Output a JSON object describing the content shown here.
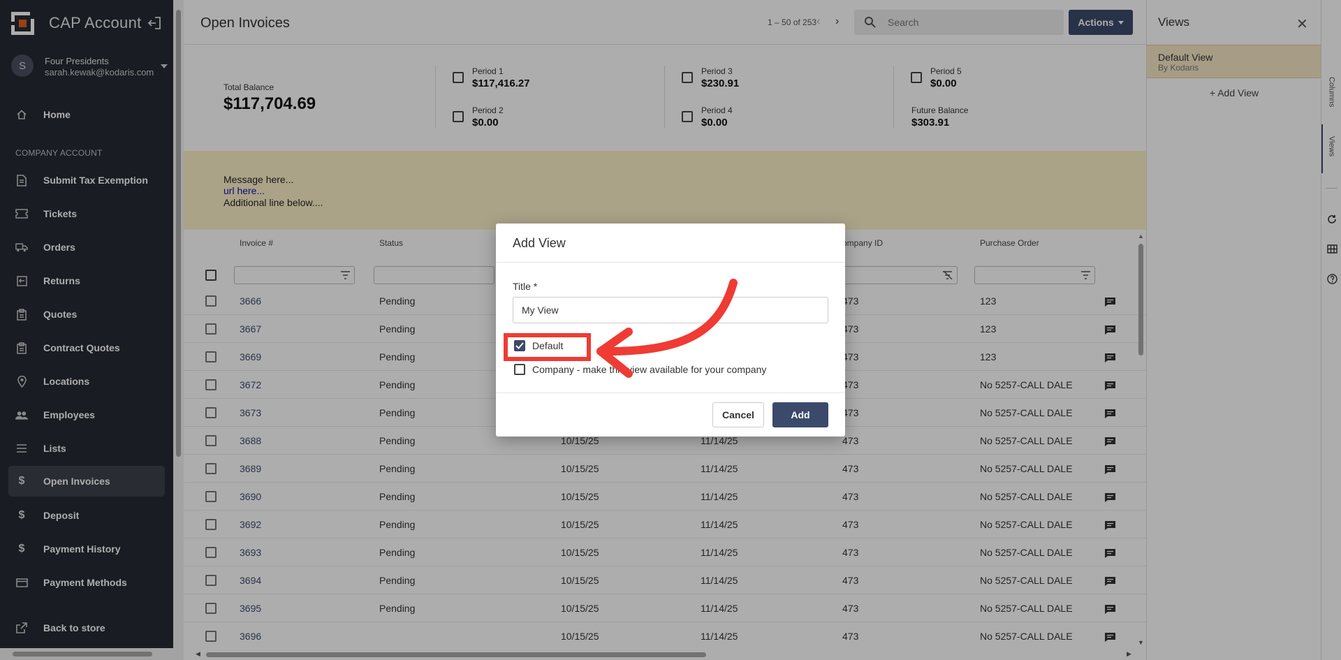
{
  "app": {
    "title": "CAP Account"
  },
  "user": {
    "initial": "S",
    "name": "Four Presidents",
    "email": "sarah.kewak@kodaris.com"
  },
  "sidebar": {
    "section_label": "COMPANY ACCOUNT",
    "items": [
      {
        "label": "Home",
        "icon": "home-icon"
      },
      {
        "label": "Submit Tax Exemption",
        "icon": "document-icon"
      },
      {
        "label": "Tickets",
        "icon": "ticket-icon"
      },
      {
        "label": "Orders",
        "icon": "truck-icon"
      },
      {
        "label": "Returns",
        "icon": "return-icon"
      },
      {
        "label": "Quotes",
        "icon": "clipboard-icon"
      },
      {
        "label": "Contract Quotes",
        "icon": "clipboard-icon"
      },
      {
        "label": "Locations",
        "icon": "map-pin-icon"
      },
      {
        "label": "Employees",
        "icon": "people-icon"
      },
      {
        "label": "Lists",
        "icon": "list-icon"
      },
      {
        "label": "Open Invoices",
        "icon": "dollar-icon"
      },
      {
        "label": "Deposit",
        "icon": "dollar-icon"
      },
      {
        "label": "Payment History",
        "icon": "dollar-icon"
      },
      {
        "label": "Payment Methods",
        "icon": "card-icon"
      },
      {
        "label": "Back to store",
        "icon": "external-link-icon"
      }
    ],
    "active": "Open Invoices"
  },
  "main": {
    "title": "Open Invoices",
    "pager": "1 – 50 of 253",
    "search_placeholder": "Search",
    "actions_label": "Actions"
  },
  "summary": {
    "total_label": "Total Balance",
    "total_value": "$117,704.69",
    "periods": [
      {
        "label": "Period 1",
        "value": "$117,416.27"
      },
      {
        "label": "Period 2",
        "value": "$0.00"
      },
      {
        "label": "Period 3",
        "value": "$230.91"
      },
      {
        "label": "Period 4",
        "value": "$0.00"
      },
      {
        "label": "Period 5",
        "value": "$0.00"
      }
    ],
    "future_label": "Future Balance",
    "future_value": "$303.91"
  },
  "message": {
    "line1": "Message here...",
    "line2": "url here...",
    "line3": "Additional line below...."
  },
  "table": {
    "headers": [
      "Invoice #",
      "Status",
      "",
      "",
      "ompany ID",
      "Purchase Order"
    ],
    "rows": [
      [
        "3666",
        "Pending",
        "",
        "",
        "473",
        "123"
      ],
      [
        "3667",
        "Pending",
        "",
        "",
        "473",
        "123"
      ],
      [
        "3669",
        "Pending",
        "",
        "",
        "473",
        "123"
      ],
      [
        "3672",
        "Pending",
        "",
        "",
        "473",
        "No 5257-CALL DALE"
      ],
      [
        "3673",
        "Pending",
        "",
        "",
        "473",
        "No 5257-CALL DALE"
      ],
      [
        "3688",
        "Pending",
        "10/15/25",
        "11/14/25",
        "473",
        "No 5257-CALL DALE"
      ],
      [
        "3689",
        "Pending",
        "10/15/25",
        "11/14/25",
        "473",
        "No 5257-CALL DALE"
      ],
      [
        "3690",
        "Pending",
        "10/15/25",
        "11/14/25",
        "473",
        "No 5257-CALL DALE"
      ],
      [
        "3692",
        "Pending",
        "10/15/25",
        "11/14/25",
        "473",
        "No 5257-CALL DALE"
      ],
      [
        "3693",
        "Pending",
        "10/15/25",
        "11/14/25",
        "473",
        "No 5257-CALL DALE"
      ],
      [
        "3694",
        "Pending",
        "10/15/25",
        "11/14/25",
        "473",
        "No 5257-CALL DALE"
      ],
      [
        "3695",
        "Pending",
        "10/15/25",
        "11/14/25",
        "473",
        "No 5257-CALL DALE"
      ],
      [
        "3696",
        "",
        "10/15/25",
        "11/14/25",
        "473",
        "No 5257-CALL DALE"
      ]
    ]
  },
  "views_panel": {
    "title": "Views",
    "default_view_name": "Default View",
    "default_view_by": "By Kodaris",
    "add_view_label": "+ Add View"
  },
  "rail": {
    "tabs": [
      "Columns",
      "Views"
    ]
  },
  "dialog": {
    "title": "Add View",
    "title_label": "Title *",
    "title_value": "My View",
    "default_label": "Default",
    "default_checked": true,
    "company_label": "Company - make this view available for your company",
    "company_checked": false,
    "cancel_label": "Cancel",
    "add_label": "Add"
  },
  "colors": {
    "accent": "#3b4a6b",
    "sidebar": "#262a33",
    "highlight": "#ef3b34",
    "banner": "#fdf0c9"
  }
}
